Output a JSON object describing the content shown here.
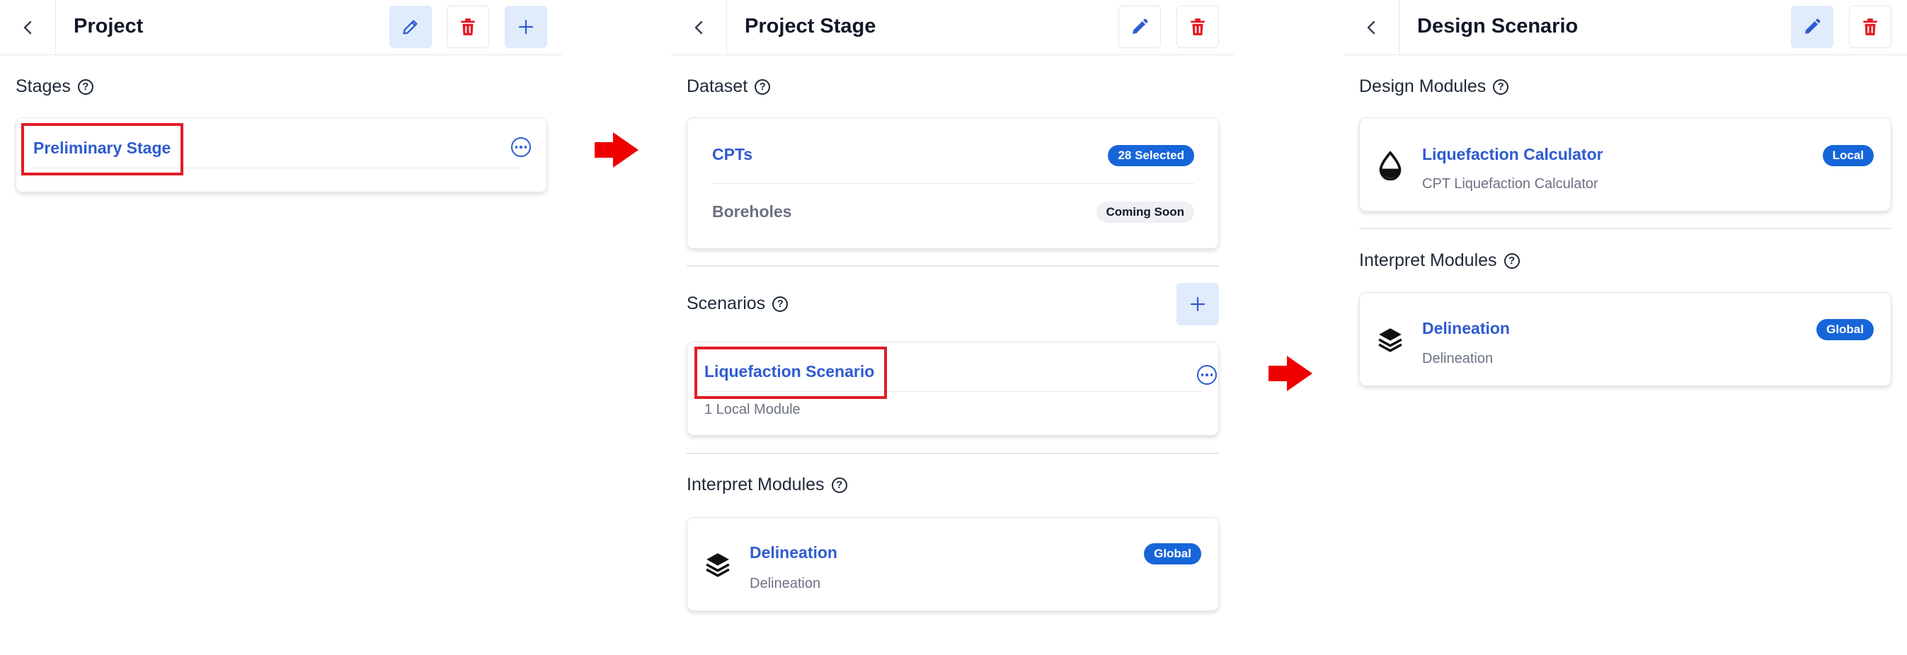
{
  "colors": {
    "accent": "#2f5bd0",
    "badge": "#1666d9",
    "danger": "#e11d26",
    "arrow": "#ee0000"
  },
  "panel1": {
    "title": "Project",
    "section": "Stages",
    "stage_link": "Preliminary Stage"
  },
  "panel2": {
    "title": "Project Stage",
    "dataset_section": "Dataset",
    "dataset_items": [
      {
        "label": "CPTs",
        "badge": "28 Selected"
      },
      {
        "label": "Boreholes",
        "badge": "Coming Soon"
      }
    ],
    "scenarios_section": "Scenarios",
    "scenario": {
      "name": "Liquefaction Scenario",
      "detail": "1 Local Module"
    },
    "interpret_section": "Interpret Modules",
    "interpret_module": {
      "name": "Delineation",
      "description": "Delineation",
      "badge": "Global"
    }
  },
  "panel3": {
    "title": "Design Scenario",
    "design_section": "Design Modules",
    "design_module": {
      "name": "Liquefaction Calculator",
      "description": "CPT Liquefaction Calculator",
      "badge": "Local"
    },
    "interpret_section": "Interpret Modules",
    "interpret_module": {
      "name": "Delineation",
      "description": "Delineation",
      "badge": "Global"
    }
  },
  "icons": [
    "chevron-left-icon",
    "pencil-icon",
    "trash-icon",
    "plus-icon",
    "help-icon",
    "more-icon",
    "droplet-icon",
    "layers-icon",
    "arrow-right-icon"
  ]
}
